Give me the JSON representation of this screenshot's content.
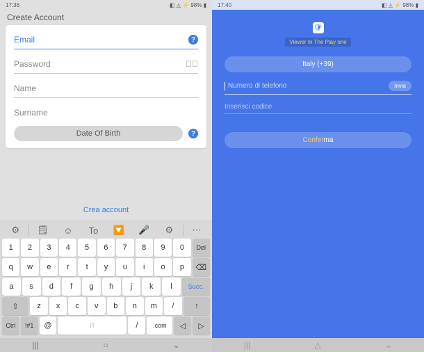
{
  "left": {
    "status": {
      "time": "17:36",
      "icons": "◧ ◬",
      "battery": "⚡ 98%",
      "signal": "▮"
    },
    "title": "Create Account",
    "fields": {
      "email": "Email",
      "password": "Password",
      "name": "Name",
      "surname": "Surname"
    },
    "dob_button": "Date Of Birth",
    "create_link": "Crea account",
    "keyboard": {
      "tools": [
        "⚙",
        "🗒",
        "☺",
        "To",
        "🔽",
        "🎤",
        "⚙",
        "⋯"
      ],
      "row1_nums": [
        "1",
        "2",
        "3",
        "4",
        "5",
        "6",
        "7",
        "8",
        "9",
        "0"
      ],
      "row1_syms": [
        "",
        "",
        "",
        "",
        "",
        "",
        "",
        "",
        "",
        "Del"
      ],
      "row2": [
        "q",
        "w",
        "e",
        "r",
        "t",
        "y",
        "u",
        "i",
        "o",
        "p"
      ],
      "row2_top": [
        "",
        "",
        "",
        "",
        "",
        "",
        "",
        "",
        "",
        "⌫"
      ],
      "row3": [
        "a",
        "s",
        "d",
        "f",
        "g",
        "h",
        "j",
        "k",
        "l"
      ],
      "row3_last": "Succ.",
      "row4_shift": "⇧",
      "row4": [
        "z",
        "x",
        "c",
        "v",
        "b",
        "n",
        "m"
      ],
      "row4_end": [
        "/",
        "↑"
      ],
      "row5": [
        "Ctrl",
        "!#1",
        "@",
        "IT",
        "/",
        ".com",
        "◁",
        "▷"
      ]
    },
    "nav": [
      "|||",
      "○",
      "⌄"
    ]
  },
  "right": {
    "status": {
      "time": "17:40",
      "icons": "◧ ◬",
      "battery": "⚡ 98%",
      "signal": "▮"
    },
    "badge": "Viewer In The Play one",
    "country": "Italy (+39)",
    "phone_placeholder": "Numero di telefono",
    "send_label": "Invia",
    "code_placeholder": "Inserisci codice",
    "confirm": {
      "part1": "Confer",
      "part2": "ma"
    },
    "nav": [
      "|||",
      "△",
      "⌄"
    ]
  }
}
